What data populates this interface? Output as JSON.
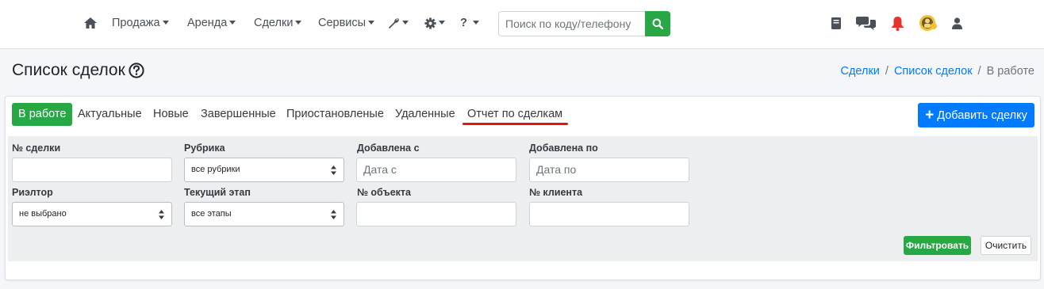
{
  "nav": {
    "home_icon": "home-icon",
    "items": [
      {
        "label": "Продажа"
      },
      {
        "label": "Аренда"
      },
      {
        "label": "Сделки"
      },
      {
        "label": "Сервисы"
      }
    ],
    "tools_icon": "wrench-icon",
    "settings_icon": "gear-icon",
    "help_label": "?",
    "search": {
      "placeholder": "Поиск по коду/телефону",
      "button_icon": "search-icon"
    },
    "right_icons": [
      "book-icon",
      "chat-icon",
      "bell-icon",
      "avatar",
      "user-icon"
    ]
  },
  "header": {
    "title": "Список сделок",
    "breadcrumb": [
      "Сделки",
      "Список сделок",
      "В работе"
    ]
  },
  "tabs": [
    {
      "label": "В работе",
      "active": true
    },
    {
      "label": "Актуальные"
    },
    {
      "label": "Новые"
    },
    {
      "label": "Завершенные"
    },
    {
      "label": "Приостановленые"
    },
    {
      "label": "Удаленные"
    },
    {
      "label": "Отчет по сделкам"
    }
  ],
  "add_button": "Добавить сделку",
  "filters": {
    "deal_number": {
      "label": "№ сделки",
      "value": ""
    },
    "rubric": {
      "label": "Рубрика",
      "value": "все рубрики"
    },
    "added_from": {
      "label": "Добавлена с",
      "placeholder": "Дата с"
    },
    "added_to": {
      "label": "Добавлена по",
      "placeholder": "Дата по"
    },
    "realtor": {
      "label": "Риэлтор",
      "value": "не выбрано"
    },
    "stage": {
      "label": "Текущий этап",
      "value": "все этапы"
    },
    "object_number": {
      "label": "№ объекта",
      "value": ""
    },
    "client_number": {
      "label": "№ клиента",
      "value": ""
    },
    "filter_button": "Фильтровать",
    "clear_button": "Очистить"
  },
  "colors": {
    "green": "#28a745",
    "blue": "#007bff",
    "red_underline": "#e8130f",
    "bell": "#e3342f"
  }
}
